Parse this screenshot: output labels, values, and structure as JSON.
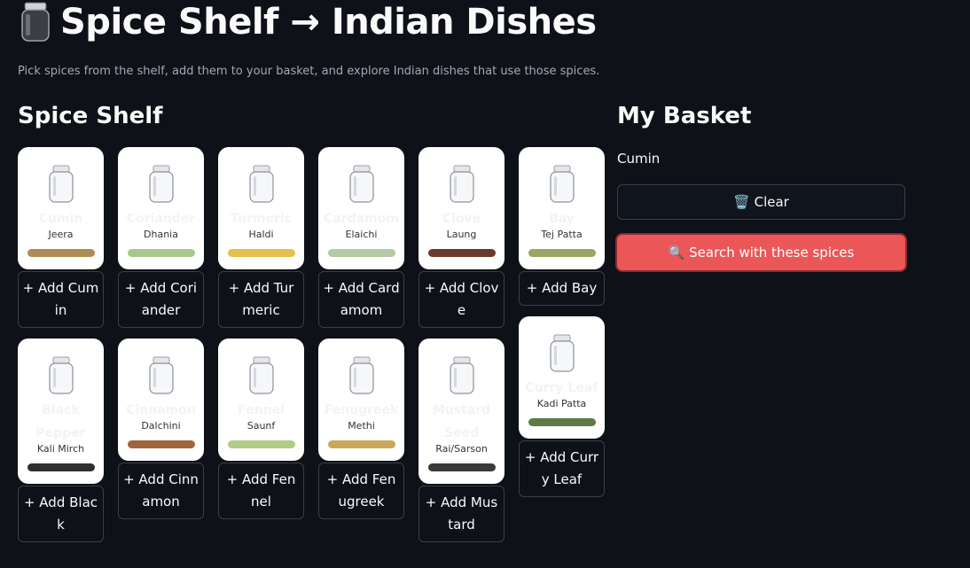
{
  "page": {
    "title": "Spice Shelf → Indian Dishes",
    "subtitle": "Pick spices from the shelf, add them to your basket, and explore Indian dishes that use those spices.",
    "title_icon": "jar-icon"
  },
  "shelf": {
    "title": "Spice Shelf",
    "spices": [
      {
        "name": "Cumin",
        "hindi": "Jeera",
        "color": "#b08c55",
        "button": "+ Add Cumin"
      },
      {
        "name": "Coriander",
        "hindi": "Dhania",
        "color": "#a9c98c",
        "button": "+ Add Coriander"
      },
      {
        "name": "Turmeric",
        "hindi": "Haldi",
        "color": "#e5c04f",
        "button": "+ Add Turmeric"
      },
      {
        "name": "Cardamom",
        "hindi": "Elaichi",
        "color": "#b5c9a4",
        "button": "+ Add Cardamom"
      },
      {
        "name": "Clove",
        "hindi": "Laung",
        "color": "#6b3a2e",
        "button": "+ Add Clove"
      },
      {
        "name": "Bay",
        "hindi": "Tej Patta",
        "color": "#98a564",
        "button": "+ Add Bay"
      },
      {
        "name": "Black Pepper",
        "hindi": "Kali Mirch",
        "color": "#2f2f2f",
        "button": "+ Add Black"
      },
      {
        "name": "Cinnamon",
        "hindi": "Dalchini",
        "color": "#a0643c",
        "button": "+ Add Cinnamon"
      },
      {
        "name": "Fennel",
        "hindi": "Saunf",
        "color": "#b1cc85",
        "button": "+ Add Fennel"
      },
      {
        "name": "Fenugreek",
        "hindi": "Methi",
        "color": "#c9a85a",
        "button": "+ Add Fenugreek"
      },
      {
        "name": "Mustard Seed",
        "hindi": "Rai/Sarson",
        "color": "#3a3a3a",
        "button": "+ Add Mustard"
      },
      {
        "name": "Curry Leaf",
        "hindi": "Kadi Patta",
        "color": "#5e7a48",
        "button": "+ Add Curry Leaf"
      }
    ]
  },
  "basket": {
    "title": "My Basket",
    "items": [
      "Cumin"
    ],
    "clear_label": "🗑️ Clear",
    "search_label": "🔍 Search with these spices"
  }
}
